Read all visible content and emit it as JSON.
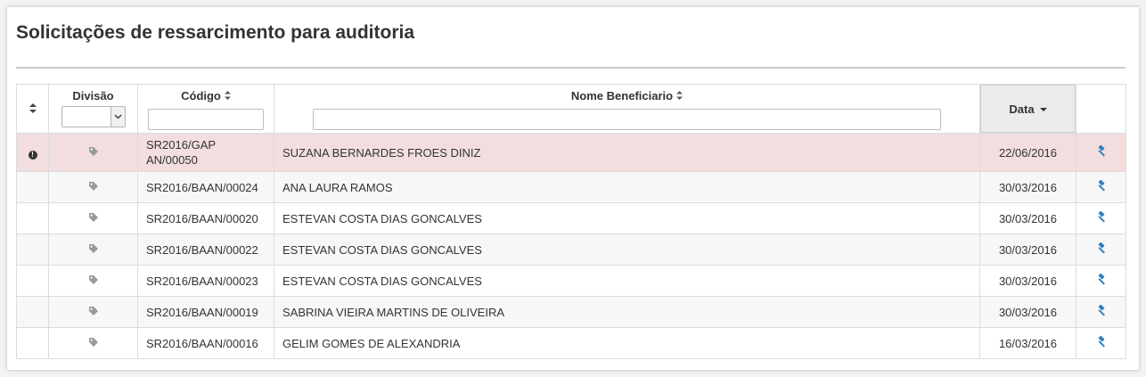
{
  "page": {
    "title": "Solicitações de ressarcimento para auditoria"
  },
  "table": {
    "columns": {
      "division": "Divisão",
      "code": "Código",
      "name": "Nome Beneficiario",
      "date": "Data"
    },
    "division_filter_value": "",
    "code_filter_value": "",
    "name_filter_value": "",
    "rows": [
      {
        "code": "SR2016/GAP\nAN/00050",
        "name": "SUZANA BERNARDES FROES DINIZ",
        "date": "22/06/2016",
        "status": "alert"
      },
      {
        "code": "SR2016/BAAN/00024",
        "name": "ANA LAURA RAMOS",
        "date": "30/03/2016",
        "status": ""
      },
      {
        "code": "SR2016/BAAN/00020",
        "name": "ESTEVAN COSTA DIAS GONCALVES",
        "date": "30/03/2016",
        "status": ""
      },
      {
        "code": "SR2016/BAAN/00022",
        "name": "ESTEVAN COSTA DIAS GONCALVES",
        "date": "30/03/2016",
        "status": ""
      },
      {
        "code": "SR2016/BAAN/00023",
        "name": "ESTEVAN COSTA DIAS GONCALVES",
        "date": "30/03/2016",
        "status": ""
      },
      {
        "code": "SR2016/BAAN/00019",
        "name": "SABRINA VIEIRA MARTINS DE OLIVEIRA",
        "date": "30/03/2016",
        "status": ""
      },
      {
        "code": "SR2016/BAAN/00016",
        "name": "GELIM GOMES DE ALEXANDRIA",
        "date": "16/03/2016",
        "status": ""
      }
    ]
  },
  "icons": {
    "sort": "sort-icon",
    "division": "tag-icon",
    "action": "gavel-icon",
    "alert": "exclamation-circle-icon"
  },
  "colors": {
    "alert_row": "#f2dede",
    "action_icon": "#2f7fc1",
    "tag_icon": "#9a9a9a",
    "sorted_header": "#ebebeb"
  }
}
